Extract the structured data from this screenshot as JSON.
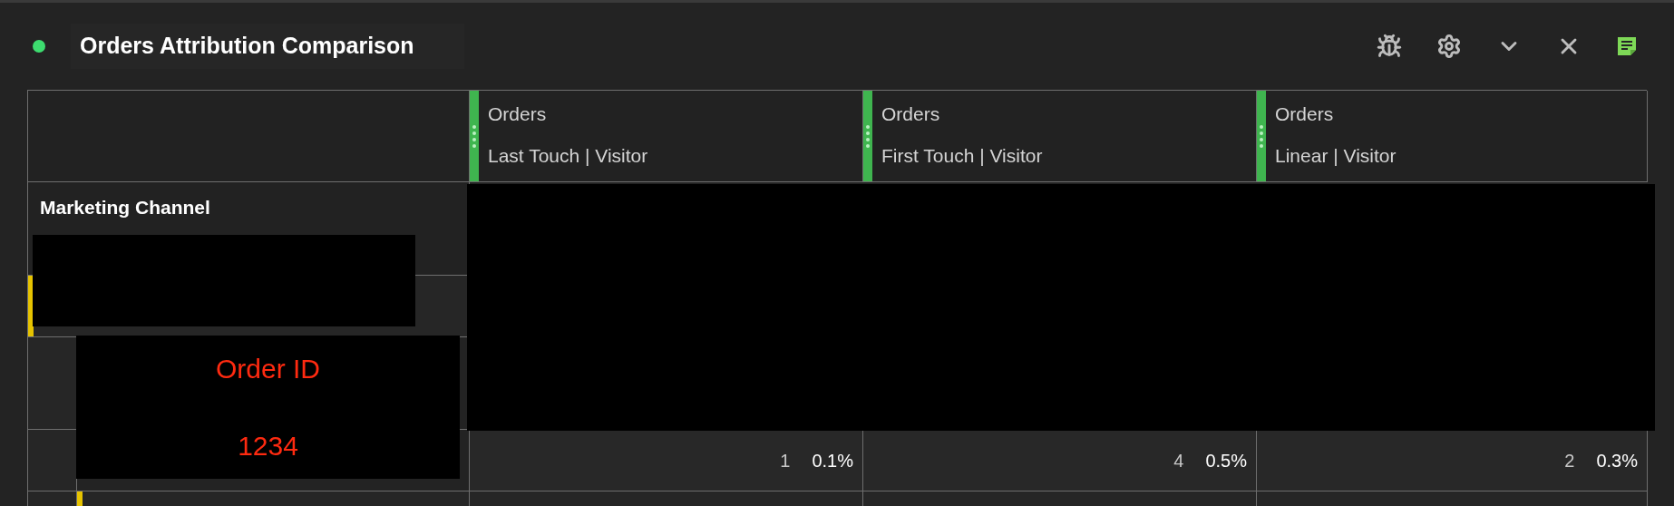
{
  "panel": {
    "title": "Orders Attribution Comparison",
    "status": {
      "color": "#3ddc6f"
    }
  },
  "table": {
    "columns": [
      {
        "metric": "Orders",
        "model": "Last Touch | Visitor"
      },
      {
        "metric": "Orders",
        "model": "First Touch | Visitor"
      },
      {
        "metric": "Orders",
        "model": "Linear | Visitor"
      }
    ],
    "dimension": "Marketing Channel",
    "rows": [
      {
        "cells": [
          {
            "value": "1",
            "percent": "0.1%"
          },
          {
            "value": "4",
            "percent": "0.5%"
          },
          {
            "value": "2",
            "percent": "0.3%"
          }
        ]
      }
    ]
  },
  "annotation": {
    "label": "Order ID",
    "value": "1234"
  }
}
